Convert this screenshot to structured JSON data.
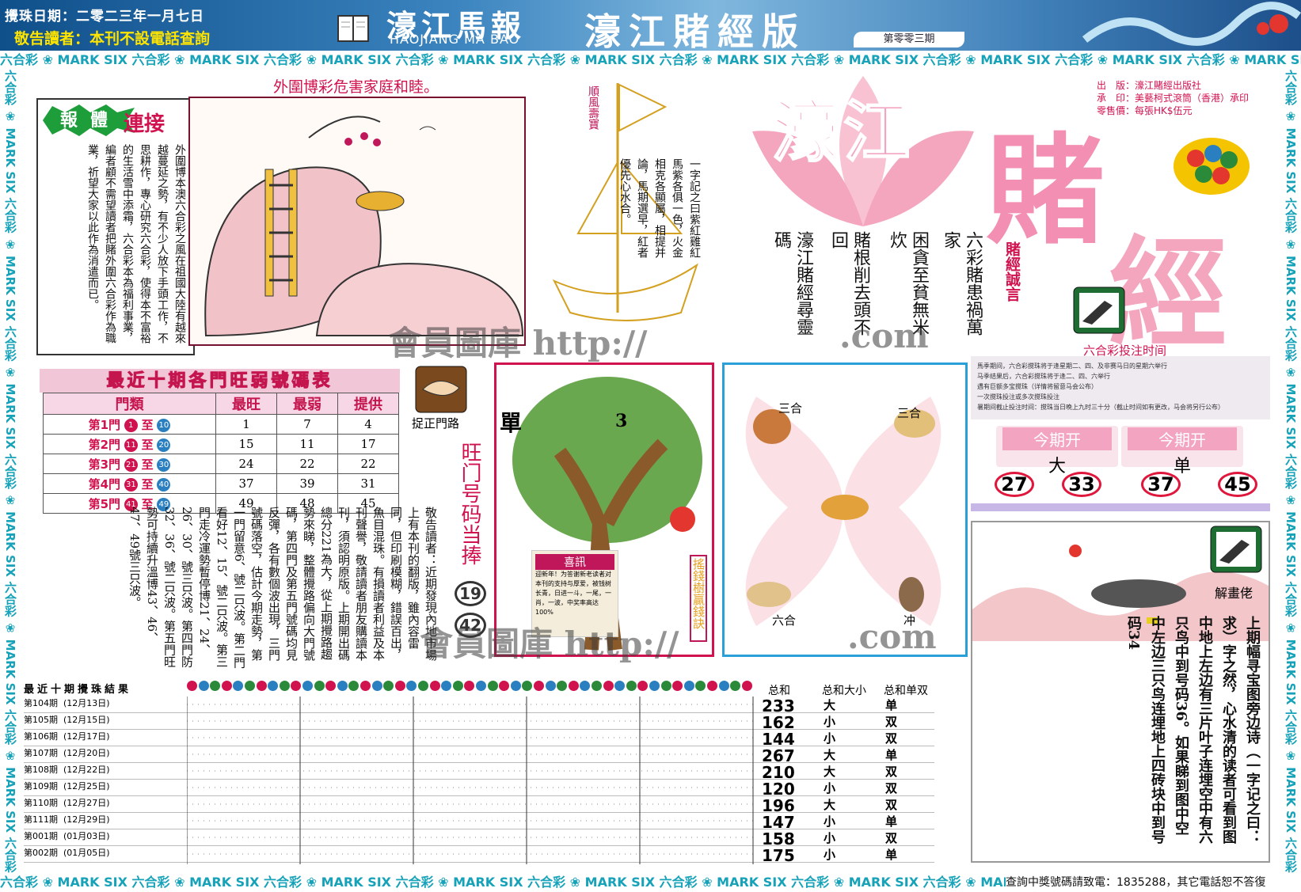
{
  "header": {
    "date": "攪珠日期：二零二三年一月七日",
    "notice": "敬告讀者：本刊不設電話查詢",
    "logo_cn": "濠江馬報",
    "logo_en": "HAOJIANG MA BAO",
    "title": "濠江賭經版",
    "issue": "第零零三期"
  },
  "band_text": "六合彩 ❀ MARK SIX 六合彩 ❀ MARK SIX 六合彩 ❀ MARK SIX 六合彩 ❀ MARK SIX 六合彩 ❀ MARK SIX 六合彩 ❀ MARK SIX 六合彩 ❀ MARK SIX 六合彩 ❀ MARK SIX 六合彩 ❀ MARK SIX 六合彩 ❀ MARK SIX",
  "warning_title": "外圍博彩危害家庭和睦。",
  "sports": {
    "tag1": "報",
    "tag2": "體",
    "tag3": "連接",
    "text": "外圍博本澳六合彩之風在祖國大陸有越來越蔓延之勢，有不少人放下手頭工作，不思耕作，專心研究六合彩，使得本不富裕的生活雪中添霜，六合彩本為福利事業，編者顧不需望讀者把賭外圍六合彩作為職業，祈望大家以此作為消遣而已。"
  },
  "ship": {
    "flag": "順風壽寶",
    "poem": "一字記之曰紫紅雞紅馬紫各俱一色，火金相克各顯屬，相提并論，馬期選早，紅者優先心水合。"
  },
  "big_title": {
    "line1": "濠江",
    "line2": "賭",
    "line3": "經"
  },
  "publisher": {
    "line1": "出　版：濠江賭經出版社",
    "line2": "承　印：美藝柯式滾筒（香港）承印",
    "line3": "零售價：每張HK$伍元"
  },
  "motto": {
    "heading": "賭經誠言",
    "col1": "六彩賭患禍萬家",
    "col2": "困貪至貧無米炊",
    "col3": "賭根削去頭不回",
    "col4": "濠江賭經尋靈碼"
  },
  "time_section": {
    "title": "六合彩投注时间",
    "items": [
      "馬季期间，六合彩搅珠将于逢星期二、四、及非赛马日的星期六举行",
      "马季结果后，六合彩搅珠将于逢二、四、六举行",
      "遇有巨额多宝搅珠（详情将留意马会公布）",
      "一次搅珠投注或多次搅珠投注",
      "暑期间截止投注时间：搅珠当日晚上九时三十分（截止时间如有更改，马会将另行公布）"
    ]
  },
  "this_period": {
    "label": "今期开",
    "big": "大",
    "single": "单",
    "numbers": [
      "27",
      "33",
      "37",
      "45"
    ]
  },
  "table": {
    "title": "最近十期各門旺弱號碼表",
    "headers": [
      "門類",
      "最旺",
      "最弱",
      "提供"
    ],
    "rows": [
      {
        "name": "第1門",
        "from": "1",
        "to": "10",
        "hot": "1",
        "cold": "7",
        "pick": "4"
      },
      {
        "name": "第2門",
        "from": "11",
        "to": "20",
        "hot": "15",
        "cold": "11",
        "pick": "17"
      },
      {
        "name": "第3門",
        "from": "21",
        "to": "30",
        "hot": "24",
        "cold": "22",
        "pick": "22"
      },
      {
        "name": "第4門",
        "from": "31",
        "to": "40",
        "hot": "37",
        "cold": "39",
        "pick": "31"
      },
      {
        "name": "第5門",
        "from": "41",
        "to": "49",
        "hot": "49",
        "cold": "48",
        "pick": "45"
      }
    ],
    "to_word": "至"
  },
  "door": {
    "label": "捉正門路",
    "hot_title": "旺门号码当捧",
    "hot_nums": [
      "19",
      "42"
    ]
  },
  "article": "敬告讀者：近期發現內地市場上有本刊的翻版，雖內容雷同，但印刷模糊，錯誤百出，魚目混珠。有損讀者利益及本刊聲譽，敬請讀者朋友購讀本刊，須認明原版。上期開出碼總分221為大，從上期攪路趨勢來睇，整體攪路偏向大門號碼，第四門及第五門號碼均見反彈，各有數個波出現，三門號碼落空，估計今期走勢，第一門留意6、號二只波。第二門看好12、15、號二只波。第三門走冷運勢暫停博21、24、26、30、號三只波。第四門防32、36、號二只波。第五門旺勢可持續升溫博43、46、47、49號三只波。",
  "tree": {
    "single": "單",
    "num": "3",
    "news_title": "喜訊",
    "news_text": "迎新年！为答谢新老读者对本刊的支持与厚爱，被钱树长青，日进一斗，一尾，一肖，一波，中奖率高达100%",
    "side": "搖錢樹贏錢訣"
  },
  "zodiac": {
    "tl": "三合",
    "tr": "三合",
    "bl": "六合",
    "br": "冲"
  },
  "solution": {
    "label": "解畫佬",
    "text": "上期幅寻宝图旁边诗（一字记之曰：求）字之然，心水清的读者可看到图中地上左边有三片叶子连埋空中有六只鸟中到号码36。如果睇到图中空中左边三只鸟连埋地上四砖块中到号码34"
  },
  "results": {
    "title": "最近十期攪珠結果",
    "col_sum": "总和",
    "col_size": "总和大小",
    "col_parity": "总和单双",
    "rows": [
      {
        "label": "第104期",
        "date": "(12月13日)",
        "sum": "233",
        "size": "大",
        "parity": "单"
      },
      {
        "label": "第105期",
        "date": "(12月15日)",
        "sum": "162",
        "size": "小",
        "parity": "双"
      },
      {
        "label": "第106期",
        "date": "(12月17日)",
        "sum": "144",
        "size": "小",
        "parity": "双"
      },
      {
        "label": "第107期",
        "date": "(12月20日)",
        "sum": "267",
        "size": "大",
        "parity": "单"
      },
      {
        "label": "第108期",
        "date": "(12月22日)",
        "sum": "210",
        "size": "大",
        "parity": "双"
      },
      {
        "label": "第109期",
        "date": "(12月25日)",
        "sum": "120",
        "size": "小",
        "parity": "双"
      },
      {
        "label": "第110期",
        "date": "(12月27日)",
        "sum": "196",
        "size": "大",
        "parity": "双"
      },
      {
        "label": "第111期",
        "date": "(12月29日)",
        "sum": "147",
        "size": "小",
        "parity": "单"
      },
      {
        "label": "第001期",
        "date": "(01月03日)",
        "sum": "158",
        "size": "小",
        "parity": "双"
      },
      {
        "label": "第002期",
        "date": "(01月05日)",
        "sum": "175",
        "size": "小",
        "parity": "单"
      }
    ]
  },
  "footer": "查詢中獎號碼請致電：1835288，其它電話恕不答復",
  "watermark": {
    "w1": "會員圖庫 http://",
    "w2": ".com",
    "w3": "會員圖庫 http://",
    "w4": ".com"
  },
  "colors": {
    "red": "#d0124e",
    "band": "#16a2b8",
    "blue": "#2a7fc0",
    "green": "#2a8a3a"
  }
}
